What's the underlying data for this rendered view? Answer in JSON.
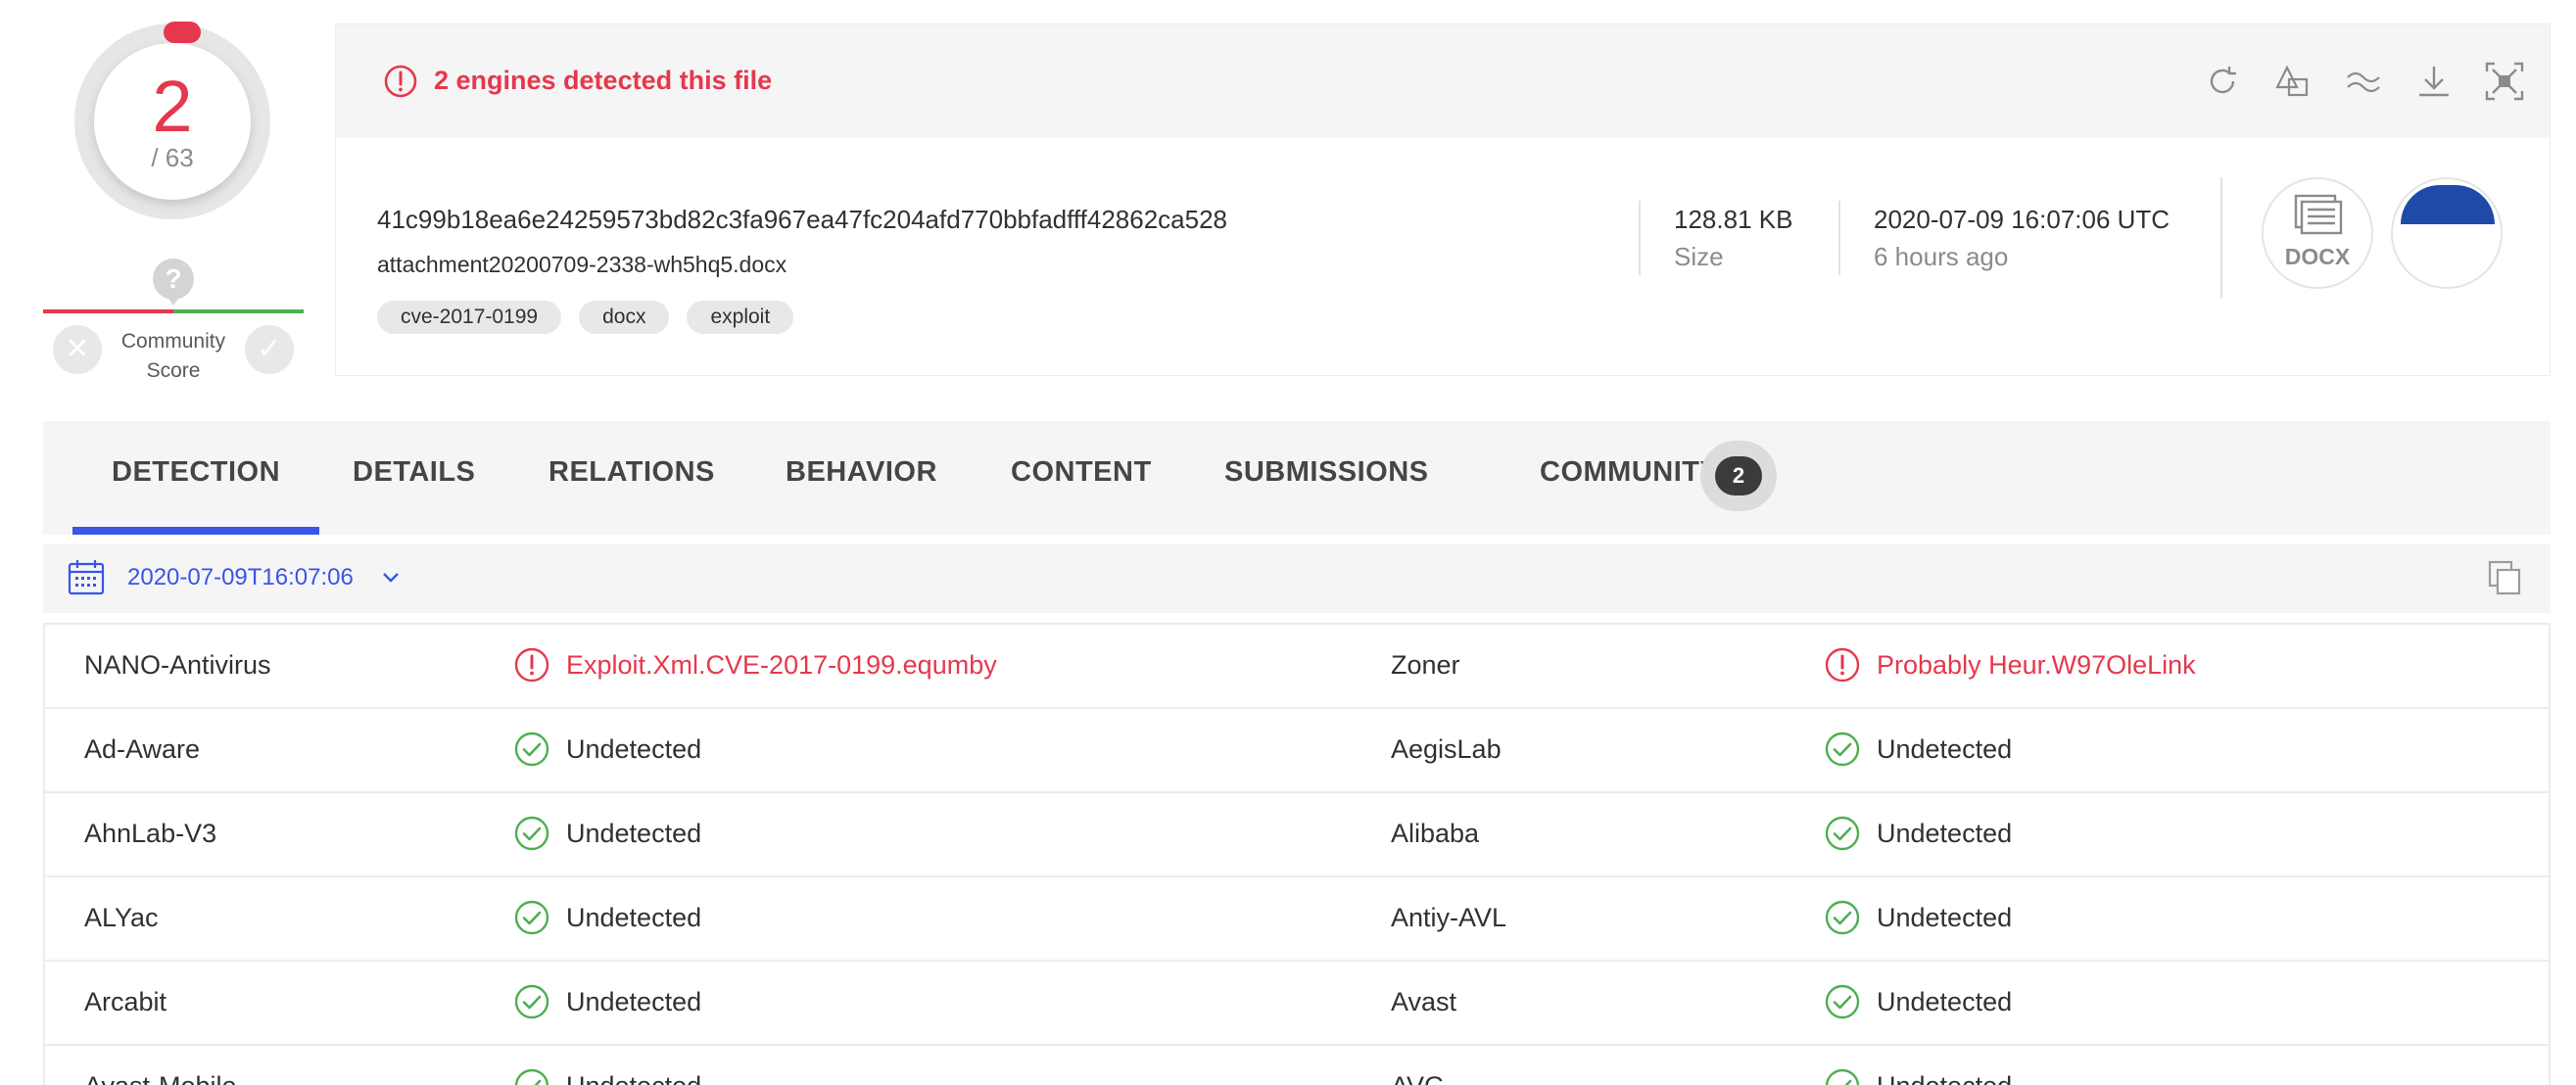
{
  "score": {
    "detected": "2",
    "total": "/ 63"
  },
  "community": {
    "question_glyph": "?",
    "label_line1": "Community",
    "label_line2": "Score",
    "negative_glyph": "✕",
    "positive_glyph": "✓"
  },
  "alert": {
    "text": "2 engines detected this file"
  },
  "toolbar": {
    "icons": [
      "reanalyze-icon",
      "similar-icon",
      "graph-icon",
      "download-icon",
      "expand-icon"
    ]
  },
  "file": {
    "hash": "41c99b18ea6e24259573bd82c3fa967ea47fc204afd770bbfadfff42862ca528",
    "name": "attachment20200709-2338-wh5hq5.docx",
    "tags": [
      "cve-2017-0199",
      "docx",
      "exploit"
    ],
    "size_value": "128.81 KB",
    "size_label": "Size",
    "date_value": "2020-07-09 16:07:06 UTC",
    "date_relative": "6 hours ago",
    "type_label": "DOCX"
  },
  "tabs": [
    "DETECTION",
    "DETAILS",
    "RELATIONS",
    "BEHAVIOR",
    "CONTENT",
    "SUBMISSIONS",
    "COMMUNITY"
  ],
  "community_count": "2",
  "analysis_date": "2020-07-09T16:07:06",
  "colors": {
    "accent": "#3a55e6",
    "detected": "#e5384c",
    "clean": "#4caf50"
  },
  "detections": [
    {
      "engine": "NANO-Antivirus",
      "result": "Exploit.Xml.CVE-2017-0199.equmby",
      "status": "detected"
    },
    {
      "engine": "Zoner",
      "result": "Probably Heur.W97OleLink",
      "status": "detected"
    },
    {
      "engine": "Ad-Aware",
      "result": "Undetected",
      "status": "clean"
    },
    {
      "engine": "AegisLab",
      "result": "Undetected",
      "status": "clean"
    },
    {
      "engine": "AhnLab-V3",
      "result": "Undetected",
      "status": "clean"
    },
    {
      "engine": "Alibaba",
      "result": "Undetected",
      "status": "clean"
    },
    {
      "engine": "ALYac",
      "result": "Undetected",
      "status": "clean"
    },
    {
      "engine": "Antiy-AVL",
      "result": "Undetected",
      "status": "clean"
    },
    {
      "engine": "Arcabit",
      "result": "Undetected",
      "status": "clean"
    },
    {
      "engine": "Avast",
      "result": "Undetected",
      "status": "clean"
    },
    {
      "engine": "Avast-Mobile",
      "result": "Undetected",
      "status": "clean"
    },
    {
      "engine": "AVG",
      "result": "Undetected",
      "status": "clean"
    }
  ]
}
